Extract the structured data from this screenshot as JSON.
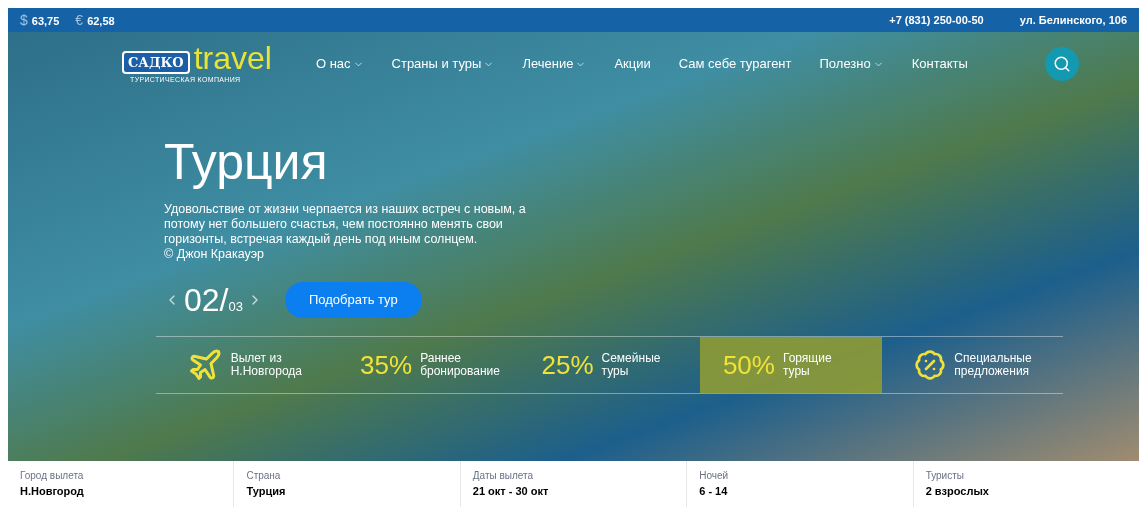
{
  "top_bar": {
    "rates": [
      {
        "symbol": "$",
        "value": "63,75"
      },
      {
        "symbol": "€",
        "value": "62,58"
      }
    ],
    "phone": "+7 (831) 250-00-50",
    "address": "ул. Белинского, 106"
  },
  "logo": {
    "badge": "САДКО",
    "word": "travel",
    "tagline": "ТУРИСТИЧЕСКАЯ КОМПАНИЯ"
  },
  "nav": [
    {
      "label": "О нас",
      "dropdown": true
    },
    {
      "label": "Страны и туры",
      "dropdown": true
    },
    {
      "label": "Лечение",
      "dropdown": true
    },
    {
      "label": "Акции",
      "dropdown": false
    },
    {
      "label": "Сам себе турагент",
      "dropdown": false
    },
    {
      "label": "Полезно",
      "dropdown": true
    },
    {
      "label": "Контакты",
      "dropdown": false
    }
  ],
  "hero": {
    "title": "Турция",
    "quote": "Удовольствие от жизни черпается из наших встреч с новым, а потому нет большего счастья, чем постоянно менять свои горизонты, встречая каждый день под иным солнцем.",
    "author": "© Джон Кракауэр",
    "slide_current": "02/",
    "slide_total": "03",
    "button": "Подобрать тур"
  },
  "features": [
    {
      "kind": "plane",
      "text": "Вылет из Н.Новгорода",
      "selected": false
    },
    {
      "kind": "percent",
      "big": "35%",
      "text": "Раннее бронирование",
      "selected": false
    },
    {
      "kind": "percent",
      "big": "25%",
      "text": "Семейные туры",
      "selected": false
    },
    {
      "kind": "percent",
      "big": "50%",
      "text": "Горящие туры",
      "selected": true
    },
    {
      "kind": "badge",
      "text": "Специальные предложения",
      "selected": false
    }
  ],
  "search_form": [
    {
      "label": "Город вылета",
      "value": "Н.Новгород"
    },
    {
      "label": "Страна",
      "value": "Турция"
    },
    {
      "label": "Даты вылета",
      "value": "21 окт - 30 окт"
    },
    {
      "label": "Ночей",
      "value": "6 - 14"
    },
    {
      "label": "Туристы",
      "value": "2 взрослых"
    }
  ]
}
